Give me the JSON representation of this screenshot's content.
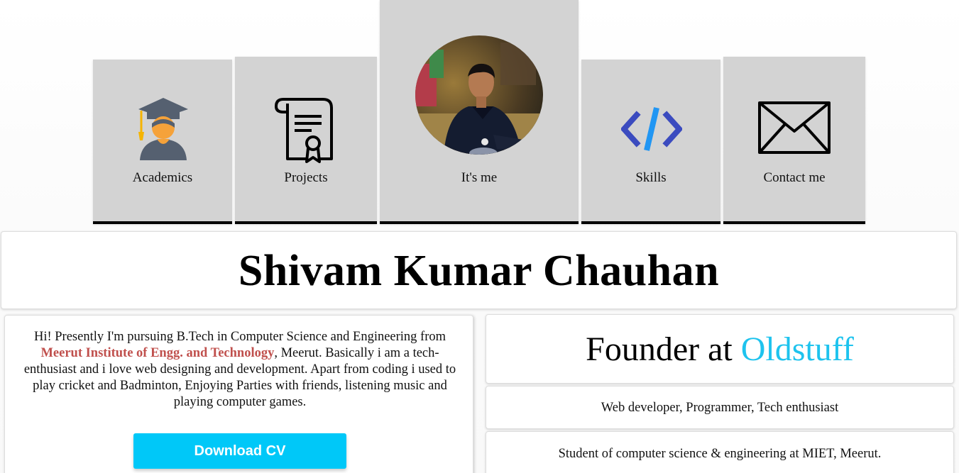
{
  "nav": {
    "tiles": [
      {
        "label": "Academics",
        "icon": "graduate-icon"
      },
      {
        "label": "Projects",
        "icon": "certificate-scroll-icon"
      },
      {
        "label": "It's me",
        "icon": "profile-photo"
      },
      {
        "label": "Skills",
        "icon": "code-icon"
      },
      {
        "label": "Contact me",
        "icon": "envelope-icon"
      }
    ]
  },
  "profile": {
    "name": "Shivam Kumar Chauhan"
  },
  "bio": {
    "intro": "Hi! Presently I'm pursuing B.Tech in Computer Science and Engineering from ",
    "institute": "Meerut Institute of Engg. and Technology",
    "rest": ", Meerut. Basically i am a tech-enthusiast and i love web designing and development. Apart from coding i used to play cricket and Badminton, Enjoying Parties with friends, listening music and playing computer games.",
    "cv_button": "Download CV"
  },
  "sidebar": {
    "founder_prefix": "Founder at ",
    "founder_brand": "Oldstuff",
    "role": "Web developer, Programmer, Tech enthusiast",
    "student": "Student of computer science & engineering at MIET, Meerut."
  },
  "colors": {
    "tile_bg": "#d3d3d3",
    "accent_blue": "#00c8f8",
    "brand_blue": "#1ec3ee",
    "institute_red": "#c0504d",
    "code_icon_dark": "#3b4bbf",
    "code_icon_light": "#2196f3"
  }
}
